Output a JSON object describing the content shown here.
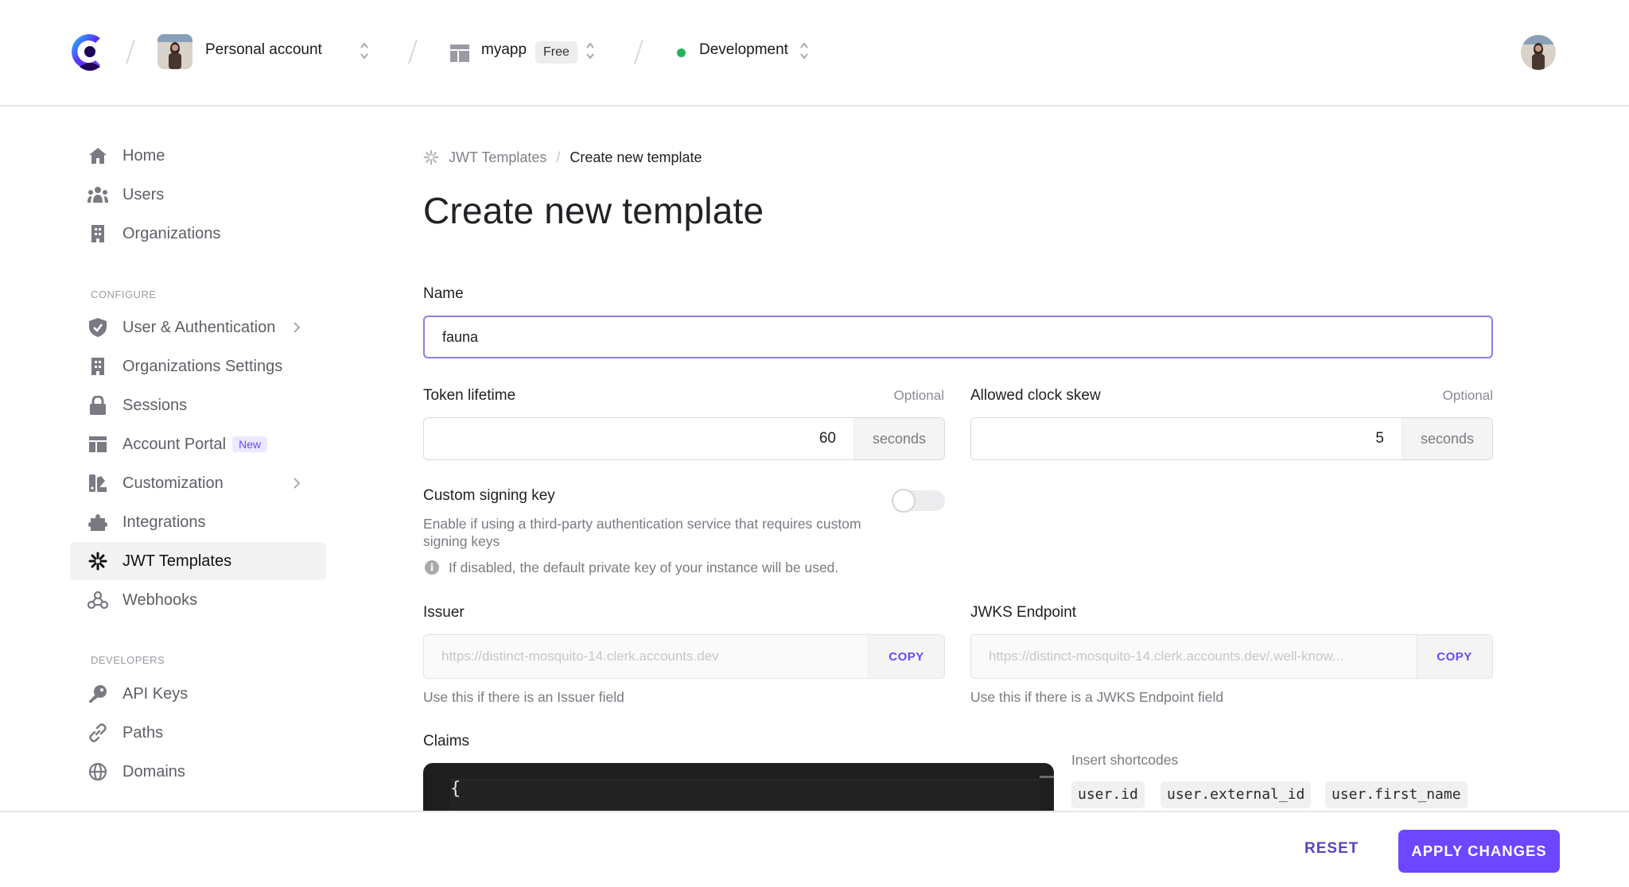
{
  "header": {
    "account_name": "Personal account",
    "app_name": "myapp",
    "app_plan_badge": "Free",
    "environment": "Development",
    "environment_color": "#22b35e"
  },
  "sidebar": {
    "items": [
      {
        "label": "Home",
        "icon": "home-icon"
      },
      {
        "label": "Users",
        "icon": "users-icon"
      },
      {
        "label": "Organizations",
        "icon": "building-icon"
      }
    ],
    "configure_label": "CONFIGURE",
    "configure_items": [
      {
        "label": "User & Authentication",
        "icon": "shield-check-icon",
        "has_chevron": true
      },
      {
        "label": "Organizations Settings",
        "icon": "building-icon"
      },
      {
        "label": "Sessions",
        "icon": "lock-icon"
      },
      {
        "label": "Account Portal",
        "icon": "layout-icon",
        "badge": "New"
      },
      {
        "label": "Customization",
        "icon": "paint-icon",
        "has_chevron": true
      },
      {
        "label": "Integrations",
        "icon": "puzzle-icon"
      },
      {
        "label": "JWT Templates",
        "icon": "asterisk-icon",
        "active": true
      },
      {
        "label": "Webhooks",
        "icon": "webhook-icon"
      }
    ],
    "developers_label": "DEVELOPERS",
    "developers_items": [
      {
        "label": "API Keys",
        "icon": "key-icon"
      },
      {
        "label": "Paths",
        "icon": "link-icon"
      },
      {
        "label": "Domains",
        "icon": "globe-icon"
      }
    ]
  },
  "breadcrumb": {
    "parent": "JWT Templates",
    "separator": "/",
    "current": "Create new template"
  },
  "page_title": "Create new template",
  "form": {
    "name": {
      "label": "Name",
      "value": "fauna"
    },
    "token_lifetime": {
      "label": "Token lifetime",
      "optional": "Optional",
      "value": "60",
      "suffix": "seconds"
    },
    "clock_skew": {
      "label": "Allowed clock skew",
      "optional": "Optional",
      "value": "5",
      "suffix": "seconds"
    },
    "signing_key": {
      "label": "Custom signing key",
      "enabled": false,
      "description": "Enable if using a third-party authentication service that requires custom signing keys",
      "info": "If disabled, the default private key of your instance will be used."
    },
    "issuer": {
      "label": "Issuer",
      "value": "https://distinct-mosquito-14.clerk.accounts.dev",
      "copy_label": "COPY",
      "help": "Use this if there is an Issuer field"
    },
    "jwks": {
      "label": "JWKS Endpoint",
      "value": "https://distinct-mosquito-14.clerk.accounts.dev/.well-know...",
      "copy_label": "COPY",
      "help": "Use this if there is a JWKS Endpoint field"
    },
    "claims": {
      "label": "Claims",
      "code_first_line": "{"
    },
    "shortcodes": {
      "label": "Insert shortcodes",
      "items": [
        "user.id",
        "user.external_id",
        "user.first_name"
      ]
    }
  },
  "footer": {
    "reset_label": "RESET",
    "apply_label": "APPLY CHANGES",
    "accent_color": "#6c47ff"
  }
}
